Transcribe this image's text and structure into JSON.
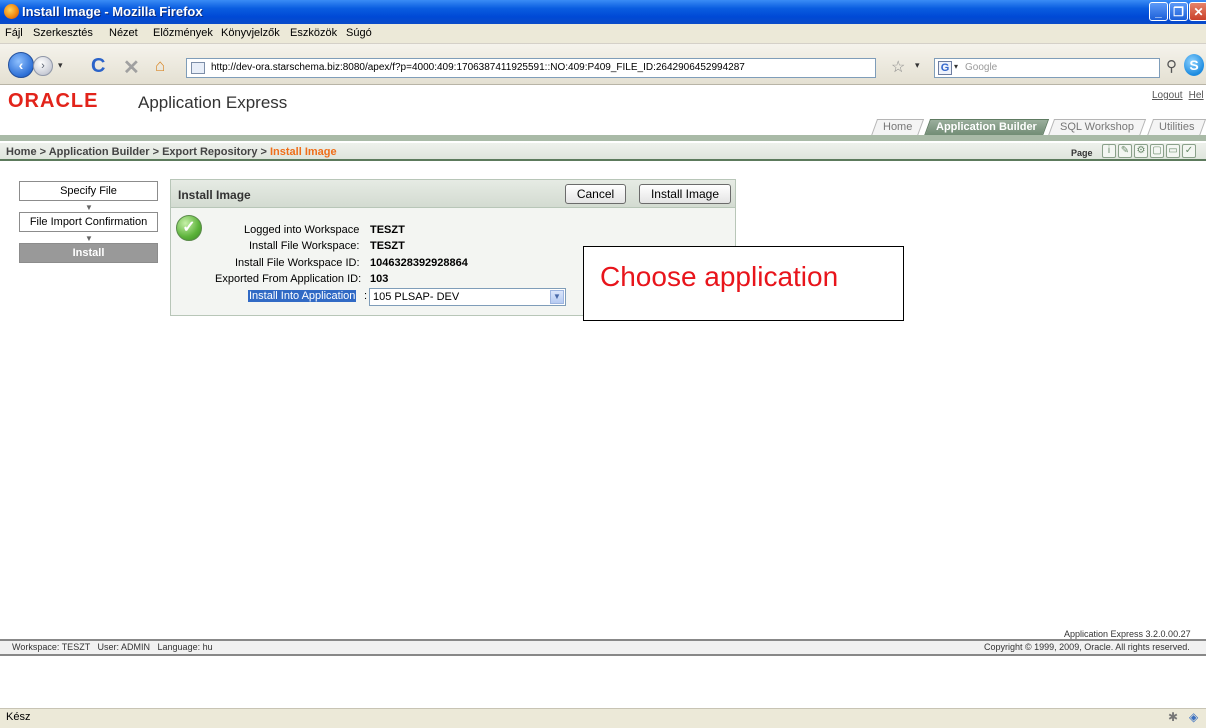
{
  "window": {
    "title": "Install Image - Mozilla Firefox",
    "buttons": {
      "minimize": "_",
      "maximize": "❐",
      "close": "✕"
    }
  },
  "menu": [
    "Fájl",
    "Szerkesztés",
    "Nézet",
    "Előzmények",
    "Könyvjelzők",
    "Eszközök",
    "Súgó"
  ],
  "nav": {
    "url": "http://dev-ora.starschema.biz:8080/apex/f?p=4000:409:1706387411925591::NO:409:P409_FILE_ID:2642906452994287",
    "search_placeholder": "Google",
    "search_engine_glyph": "G",
    "icons": [
      "back-icon",
      "forward-icon",
      "dropdown-icon",
      "reload-icon",
      "stop-icon",
      "home-icon",
      "bookmark-star-icon",
      "magnifier-icon",
      "skype-icon"
    ]
  },
  "header": {
    "brand": "ORACLE",
    "product": "Application Express",
    "links": [
      "Logout",
      "Hel"
    ]
  },
  "tabs": [
    {
      "label": "Home",
      "active": false
    },
    {
      "label": "Application Builder",
      "active": true
    },
    {
      "label": "SQL Workshop",
      "active": false
    },
    {
      "label": "Utilities",
      "active": false
    }
  ],
  "breadcrumb": {
    "items": [
      "Home",
      "Application Builder",
      "Export Repository"
    ],
    "separator": " > ",
    "current": "Install Image"
  },
  "page_toolbar": {
    "label": "Page",
    "icons": [
      "page-info-icon",
      "page-edit-icon",
      "page-settings-icon",
      "page-new-icon",
      "comment-icon",
      "page-run-icon"
    ]
  },
  "wizard": {
    "steps": [
      {
        "label": "Specify File",
        "active": false
      },
      {
        "label": "File Import Confirmation",
        "active": false
      },
      {
        "label": "Install",
        "active": true
      }
    ]
  },
  "region": {
    "title": "Install Image",
    "cancel_label": "Cancel",
    "install_label": "Install Image",
    "logged_into_label": "Logged into Workspace",
    "logged_into_value": "TESZT",
    "file_ws_label": "Install File Workspace:",
    "file_ws_value": "TESZT",
    "file_ws_id_label": "Install File Workspace ID:",
    "file_ws_id_value": "1046328392928864",
    "exported_label": "Exported From Application ID:",
    "exported_value": "103",
    "install_into_label": "Install Into Application",
    "install_into_colon": ":",
    "install_into_value": "105 PLSAP- DEV"
  },
  "callout": {
    "text": "Choose application"
  },
  "footer": {
    "version": "Application Express 3.2.0.00.27",
    "left": "Workspace: TESZT   User: ADMIN   Language: hu",
    "copyright": "Copyright © 1999, 2009, Oracle. All rights reserved."
  },
  "status": {
    "text": "Kész"
  },
  "colors": {
    "titlebar": "#0a5de0",
    "oracle_red": "#e2231a",
    "breadcrumb_current": "#ef6e1a",
    "callout_text": "#e8141b",
    "active_tab": "#6f8a72"
  }
}
